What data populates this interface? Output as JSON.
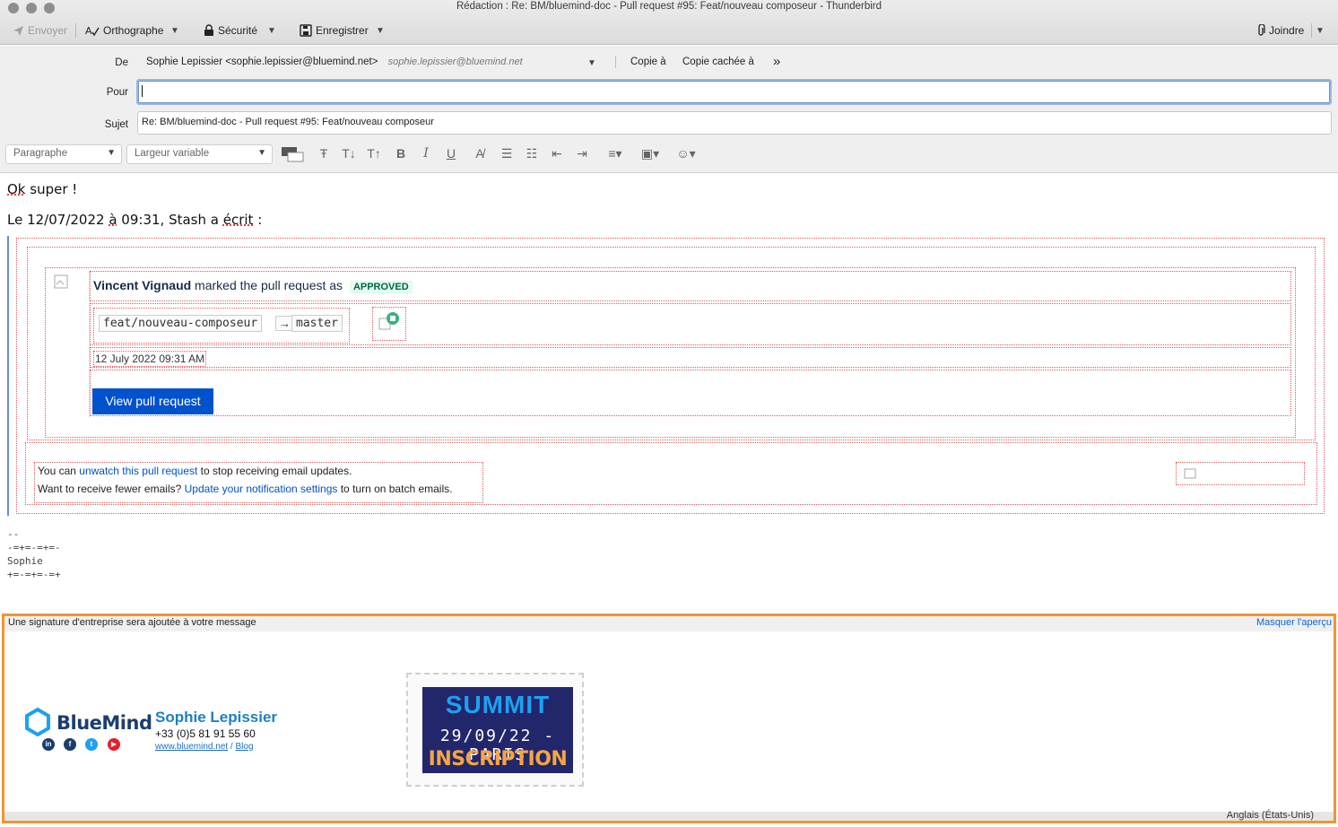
{
  "window": {
    "title": "Rédaction : Re: BM/bluemind-doc - Pull request #95: Feat/nouveau composeur - Thunderbird"
  },
  "toolbar": {
    "send_label": "Envoyer",
    "spelling_label": "Orthographe",
    "security_label": "Sécurité",
    "save_label": "Enregistrer",
    "attach_label": "Joindre"
  },
  "header": {
    "from_label": "De",
    "from_value": "Sophie Lepissier <sophie.lepissier@bluemind.net>",
    "from_identity": "sophie.lepissier@bluemind.net",
    "cc_label": "Copie à",
    "bcc_label": "Copie cachée à",
    "to_label": "Pour",
    "to_value": "",
    "subject_label": "Sujet",
    "subject_value": "Re: BM/bluemind-doc - Pull request #95: Feat/nouveau composeur"
  },
  "format": {
    "paragraph": "Paragraphe",
    "font": "Largeur variable"
  },
  "message": {
    "greeting_word": "Ok",
    "greeting_rest": " super !",
    "attrib_part1": "Le 12/07/2022 ",
    "attrib_a": "à",
    "attrib_part2": " 09:31, Stash a ",
    "attrib_ecrit": "écrit",
    "attrib_part3": " :"
  },
  "quoted": {
    "author": "Vincent Vignaud",
    "action": " marked the pull request as",
    "status": "APPROVED",
    "source_branch": "feat/nouveau-composeur",
    "target_branch": "master",
    "date": "12 July 2022 09:31 AM",
    "button": "View pull request",
    "footer_1_pre": "You can ",
    "footer_1_link": "unwatch this pull request",
    "footer_1_post": " to stop receiving email updates.",
    "footer_2_pre": "Want to receive fewer emails? ",
    "footer_2_link": "Update your notification settings",
    "footer_2_post": " to turn on batch emails."
  },
  "signature_text": "--\n-=+=-=+=-\nSophie\n+=-=+=-=+",
  "enterprise_signature": {
    "notice": "Une signature d'entreprise sera ajoutée à votre message",
    "hide_preview": "Masquer l'aperçu",
    "brand": "BlueMind",
    "name": "Sophie Lepissier",
    "phone": "+33 (0)5 81 91 55 60",
    "website": "www.bluemind.net",
    "website_sep": " / ",
    "blog": "Blog",
    "banner_title": "SUMMIT",
    "banner_date": "29/09/22 - PARIS",
    "banner_cta": "INSCRIPTION"
  },
  "status": {
    "language": "Anglais (États-Unis)"
  }
}
